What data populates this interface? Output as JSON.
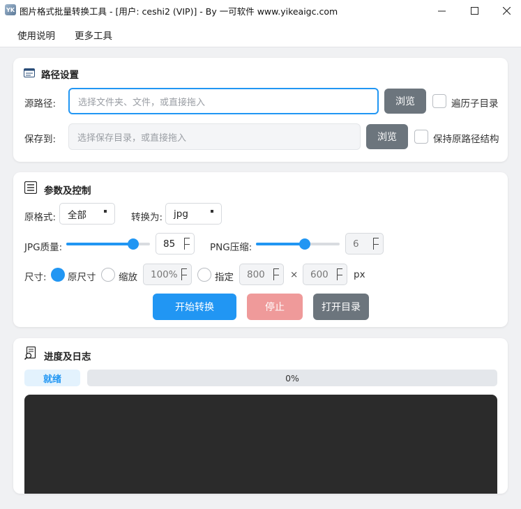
{
  "window": {
    "app_icon_text": "YK",
    "title": "图片格式批量转换工具 - [用户: ceshi2 (VIP)] - By 一可软件 www.yikeaigc.com"
  },
  "menu": {
    "items": [
      {
        "label": "使用说明"
      },
      {
        "label": "更多工具"
      }
    ]
  },
  "path_section": {
    "title": "路径设置",
    "source_label": "源路径:",
    "source_placeholder": "选择文件夹、文件，或直接拖入",
    "source_value": "",
    "browse1_label": "浏览",
    "recursive_label": "遍历子目录",
    "recursive_checked": false,
    "save_label": "保存到:",
    "save_placeholder": "选择保存目录，或直接拖入",
    "save_value": "",
    "browse2_label": "浏览",
    "keep_structure_label": "保持原路径结构",
    "keep_structure_checked": false
  },
  "params_section": {
    "title": "参数及控制",
    "source_format_label": "原格式:",
    "source_format_value": "全部",
    "convert_to_label": "转换为:",
    "convert_to_value": "jpg",
    "jpg_quality_label": "JPG质量:",
    "jpg_quality_value": "85",
    "jpg_quality_slider": 0.85,
    "png_compress_label": "PNG压缩:",
    "png_compress_value": "6",
    "png_compress_slider": 0.6,
    "size_label": "尺寸:",
    "size_options": [
      {
        "label": "原尺寸",
        "selected": true
      },
      {
        "label": "缩放",
        "selected": false
      },
      {
        "label": "指定",
        "selected": false
      }
    ],
    "scale_value": "100%",
    "width_value": "800",
    "times_symbol": "×",
    "height_value": "600",
    "unit": "px",
    "start_button": "开始转换",
    "stop_button": "停止",
    "open_dir_button": "打开目录"
  },
  "progress_section": {
    "title": "进度及日志",
    "status": "就绪",
    "progress_text": "0%",
    "progress_value": 0
  },
  "colors": {
    "accent": "#2196f3",
    "stop_button": "#ef9a9a",
    "gray_button": "#6c757d",
    "log_background": "#2b2b2b"
  }
}
